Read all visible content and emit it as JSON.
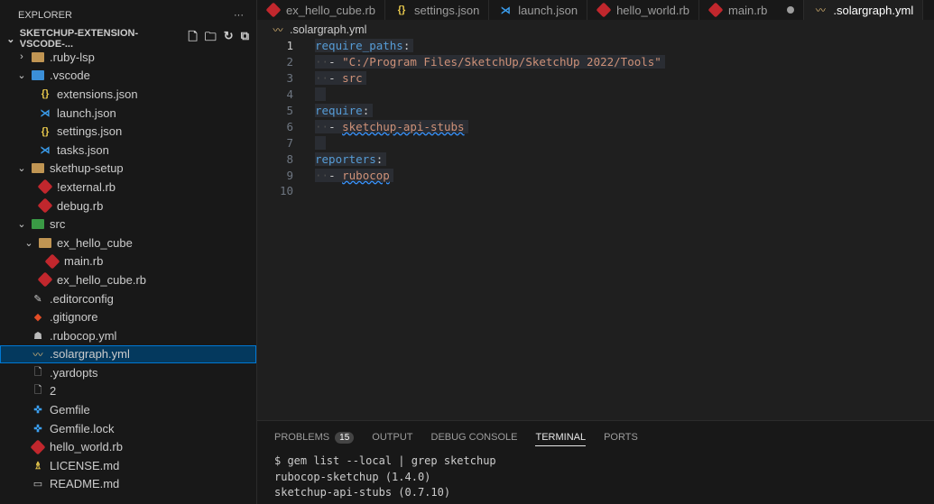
{
  "sidebar": {
    "title": "EXPLORER",
    "more": "···",
    "project": "SKETCHUP-EXTENSION-VSCODE-...",
    "items": [
      {
        "label": ".ruby-lsp",
        "icon": "folder-icon",
        "depth": 0,
        "chev": "›"
      },
      {
        "label": ".vscode",
        "icon": "vscode-folder-icon",
        "depth": 0,
        "chev": "⌄"
      },
      {
        "label": "extensions.json",
        "icon": "json-icon",
        "depth": 1
      },
      {
        "label": "launch.json",
        "icon": "vscode-icon",
        "depth": 1
      },
      {
        "label": "settings.json",
        "icon": "json-icon",
        "depth": 1
      },
      {
        "label": "tasks.json",
        "icon": "vscode-icon",
        "depth": 1
      },
      {
        "label": "skethup-setup",
        "icon": "folder-icon",
        "depth": 0,
        "chev": "⌄"
      },
      {
        "label": "!external.rb",
        "icon": "ruby-icon",
        "depth": 1
      },
      {
        "label": "debug.rb",
        "icon": "ruby-icon",
        "depth": 1
      },
      {
        "label": "src",
        "icon": "src-folder-icon",
        "depth": 0,
        "chev": "⌄"
      },
      {
        "label": "ex_hello_cube",
        "icon": "folder-icon",
        "depth": 1,
        "chev": "⌄"
      },
      {
        "label": "main.rb",
        "icon": "ruby-icon",
        "depth": 2
      },
      {
        "label": "ex_hello_cube.rb",
        "icon": "ruby-icon",
        "depth": 1
      },
      {
        "label": ".editorconfig",
        "icon": "editorconfig-icon",
        "depth": 0
      },
      {
        "label": ".gitignore",
        "icon": "git-icon",
        "depth": 0
      },
      {
        "label": ".rubocop.yml",
        "icon": "rubocop-icon",
        "depth": 0
      },
      {
        "label": ".solargraph.yml",
        "icon": "solargraph-icon",
        "depth": 0,
        "selected": true
      },
      {
        "label": ".yardopts",
        "icon": "file-icon",
        "depth": 0
      },
      {
        "label": "2",
        "icon": "file-icon",
        "depth": 0
      },
      {
        "label": "Gemfile",
        "icon": "gemfile-icon",
        "depth": 0
      },
      {
        "label": "Gemfile.lock",
        "icon": "gemfile-icon",
        "depth": 0
      },
      {
        "label": "hello_world.rb",
        "icon": "ruby-icon",
        "depth": 0
      },
      {
        "label": "LICENSE.md",
        "icon": "license-icon",
        "depth": 0
      },
      {
        "label": "README.md",
        "icon": "readme-icon",
        "depth": 0
      }
    ]
  },
  "tabs": [
    {
      "label": "ex_hello_cube.rb",
      "icon": "ruby-icon"
    },
    {
      "label": "settings.json",
      "icon": "json-icon"
    },
    {
      "label": "launch.json",
      "icon": "vscode-icon"
    },
    {
      "label": "hello_world.rb",
      "icon": "ruby-icon"
    },
    {
      "label": "main.rb",
      "icon": "ruby-icon",
      "dirty": true
    },
    {
      "label": ".solargraph.yml",
      "icon": "solargraph-icon",
      "active": true
    }
  ],
  "breadcrumb": ".solargraph.yml",
  "code": [
    [
      [
        "k",
        "require_paths"
      ],
      [
        "p",
        ":"
      ]
    ],
    [
      [
        "ws",
        "··"
      ],
      [
        "p",
        "- "
      ],
      [
        "s",
        "\"C:/Program Files/SketchUp/SketchUp 2022/Tools\""
      ]
    ],
    [
      [
        "ws",
        "··"
      ],
      [
        "p",
        "- "
      ],
      [
        "s",
        "src"
      ]
    ],
    [
      [
        "p",
        " "
      ]
    ],
    [
      [
        "k",
        "require"
      ],
      [
        "p",
        ":"
      ]
    ],
    [
      [
        "ws",
        "··"
      ],
      [
        "p",
        "- "
      ],
      [
        "s sq",
        "sketchup-api-stubs"
      ]
    ],
    [
      [
        "p",
        " "
      ]
    ],
    [
      [
        "k",
        "reporters"
      ],
      [
        "p",
        ":"
      ]
    ],
    [
      [
        "ws",
        "··"
      ],
      [
        "p",
        "- "
      ],
      [
        "s sq",
        "rubocop"
      ]
    ],
    []
  ],
  "panel": {
    "tabs": [
      "PROBLEMS",
      "OUTPUT",
      "DEBUG CONSOLE",
      "TERMINAL",
      "PORTS"
    ],
    "problems_count": "15",
    "active": "TERMINAL",
    "terminal": [
      "$ gem list --local | grep sketchup",
      "rubocop-sketchup (1.4.0)",
      "sketchup-api-stubs (0.7.10)"
    ]
  }
}
